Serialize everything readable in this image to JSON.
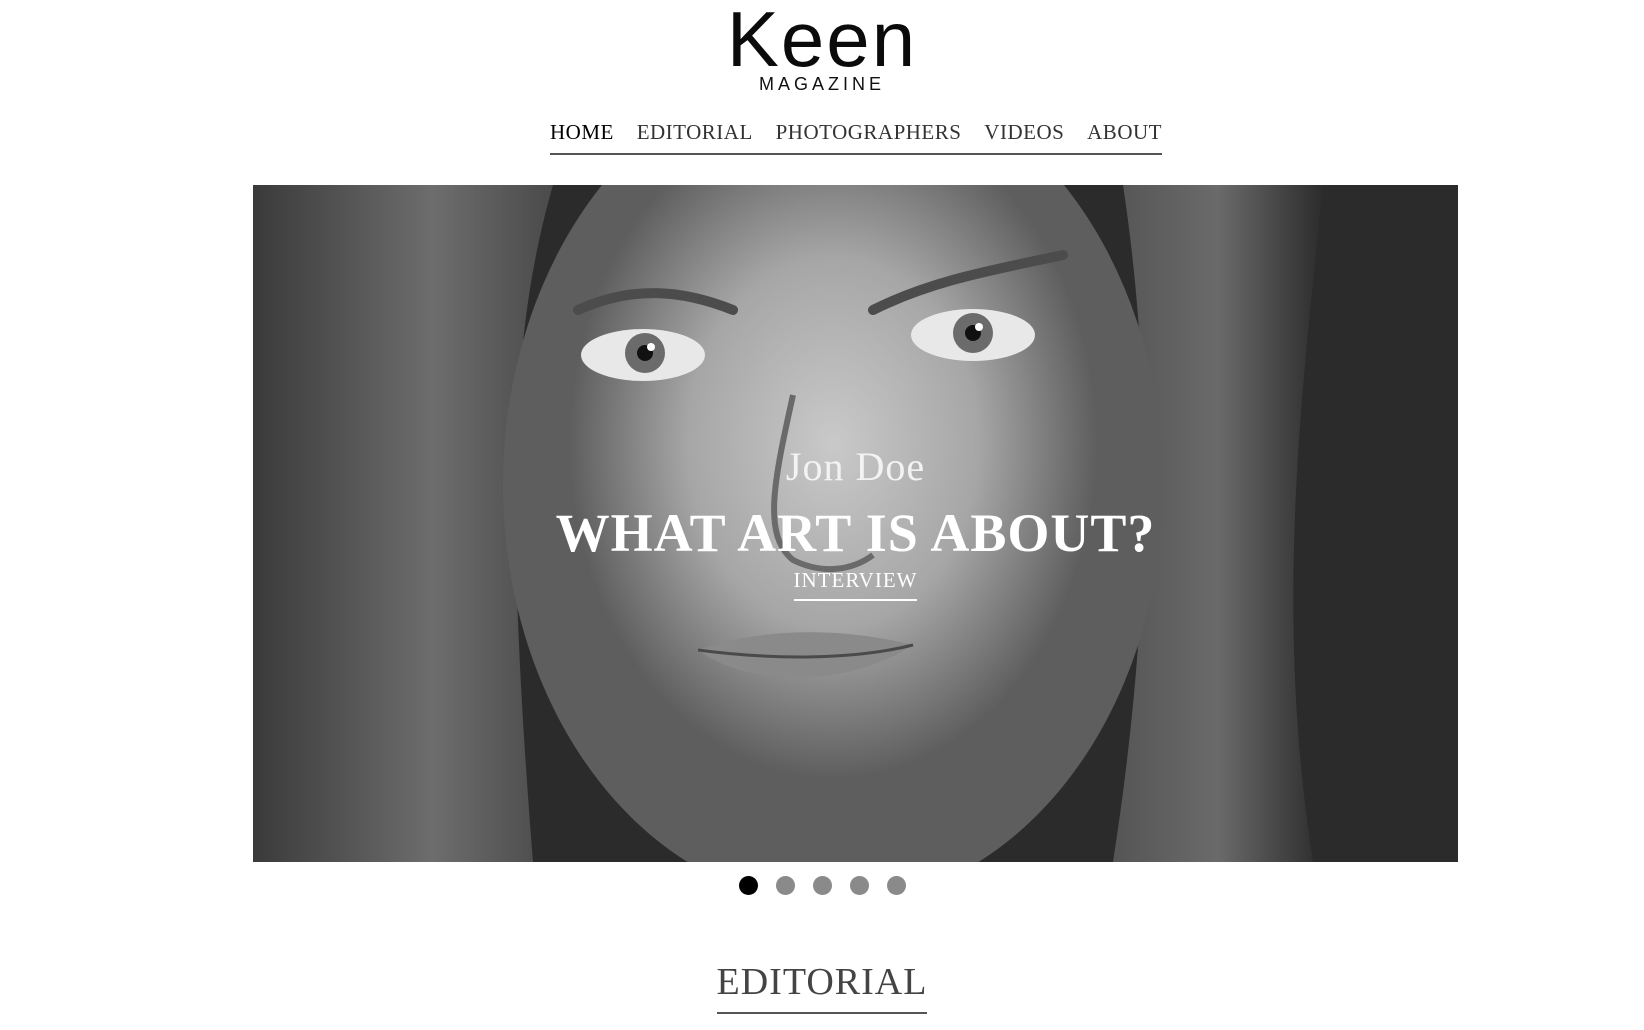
{
  "brand": {
    "logo_text": "Keen",
    "logo_subtitle": "MAGAZINE"
  },
  "nav": {
    "items": [
      {
        "label": "HOME",
        "active": true
      },
      {
        "label": "EDITORIAL"
      },
      {
        "label": "PHOTOGRAPHERS"
      },
      {
        "label": "VIDEOS"
      },
      {
        "label": "ABOUT"
      }
    ]
  },
  "hero": {
    "author": "Jon Doe",
    "title": "WHAT ART IS ABOUT?",
    "category": "INTERVIEW",
    "image": "black-and-white portrait photo"
  },
  "slider": {
    "dot_count": 5,
    "active_index": 0
  },
  "section": {
    "heading": "EDITORIAL"
  },
  "colors": {
    "dot_active": "#000000",
    "dot_inactive": "#8a8a8a",
    "text_primary": "#111111"
  }
}
